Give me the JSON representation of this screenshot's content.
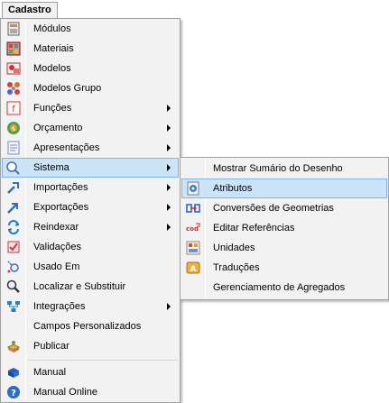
{
  "menubar": {
    "cadastro": "Cadastro"
  },
  "main_menu": {
    "items": [
      {
        "label": "Módulos",
        "icon": "modules-icon"
      },
      {
        "label": "Materiais",
        "icon": "materials-icon"
      },
      {
        "label": "Modelos",
        "icon": "models-icon"
      },
      {
        "label": "Modelos Grupo",
        "icon": "model-group-icon"
      },
      {
        "label": "Funções",
        "icon": "functions-icon"
      },
      {
        "label": "Orçamento",
        "icon": "budget-icon"
      },
      {
        "label": "Apresentações",
        "icon": "presentations-icon"
      },
      {
        "label": "Sistema",
        "icon": "system-icon"
      },
      {
        "label": "Importações",
        "icon": "imports-icon"
      },
      {
        "label": "Exportações",
        "icon": "exports-icon"
      },
      {
        "label": "Reindexar",
        "icon": "reindex-icon"
      },
      {
        "label": "Validações",
        "icon": "validations-icon"
      },
      {
        "label": "Usado Em",
        "icon": "used-in-icon"
      },
      {
        "label": "Localizar e Substituir",
        "icon": "find-replace-icon"
      },
      {
        "label": "Integrações",
        "icon": "integrations-icon"
      },
      {
        "label": "Campos Personalizados",
        "icon": ""
      },
      {
        "label": "Publicar",
        "icon": "publish-icon"
      },
      {
        "label": "Manual",
        "icon": "manual-icon"
      },
      {
        "label": "Manual Online",
        "icon": "help-icon"
      }
    ]
  },
  "sub_menu": {
    "items": [
      {
        "label": "Mostrar Sumário do Desenho"
      },
      {
        "label": "Atributos",
        "icon": "attributes-icon"
      },
      {
        "label": "Conversões de Geometrias",
        "icon": "geometry-conversion-icon"
      },
      {
        "label": "Editar Referências",
        "icon": "edit-references-icon"
      },
      {
        "label": "Unidades",
        "icon": "units-icon"
      },
      {
        "label": "Traduções",
        "icon": "translations-icon"
      },
      {
        "label": "Gerenciamento de Agregados"
      }
    ]
  },
  "colors": {
    "highlight_bg": "#cce4f7",
    "highlight_border": "#7eb4ea",
    "menu_bg": "#f2f2f2"
  }
}
